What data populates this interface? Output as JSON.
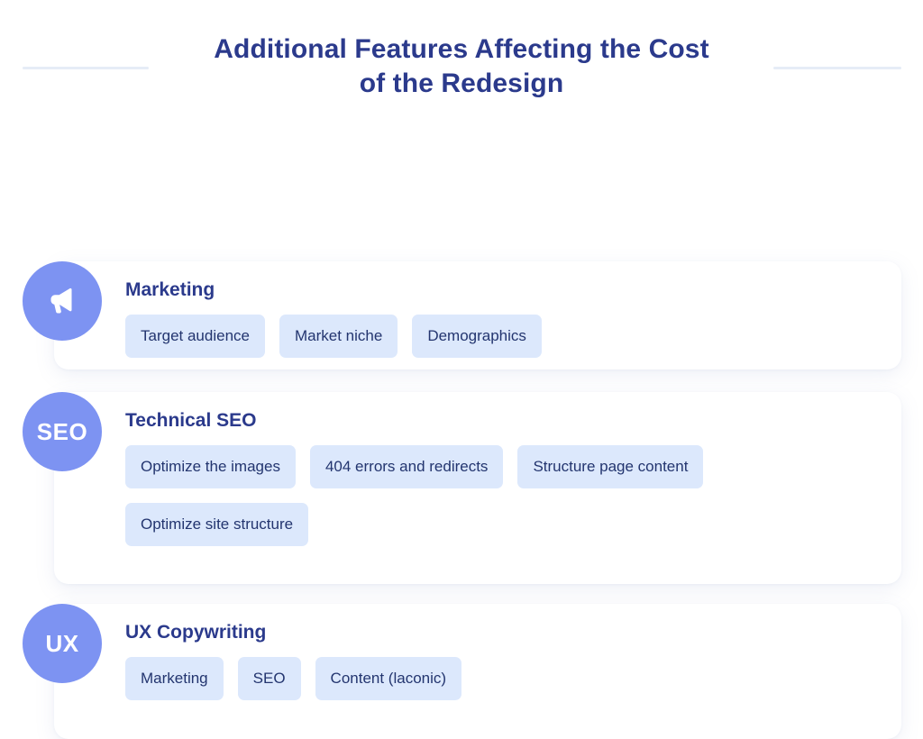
{
  "header": {
    "title_line_1": "Additional Features Affecting the Cost",
    "title_line_2": "of the Redesign",
    "rule_color": "#e6ecf7"
  },
  "theme": {
    "title_color": "#2b3a8c",
    "badge_color": "#7d93f2",
    "tag_background": "#dce8fc",
    "tag_text_color": "#23356f",
    "card_background": "#ffffff",
    "page_background": "#ffffff"
  },
  "cards": [
    {
      "badge_type": "icon",
      "badge_icon": "megaphone-icon",
      "badge_label": "",
      "heading": "Marketing",
      "tags": [
        "Target audience",
        "Market niche",
        "Demographics"
      ]
    },
    {
      "badge_type": "text",
      "badge_icon": "",
      "badge_label": "SEO",
      "heading": "Technical SEO",
      "tags": [
        "Optimize the images",
        "404 errors and redirects",
        "Structure page content",
        "Optimize site structure"
      ]
    },
    {
      "badge_type": "text",
      "badge_icon": "",
      "badge_label": "UX",
      "heading": "UX Copywriting",
      "tags": [
        "Marketing",
        "SEO",
        "Content (laconic)"
      ]
    }
  ]
}
